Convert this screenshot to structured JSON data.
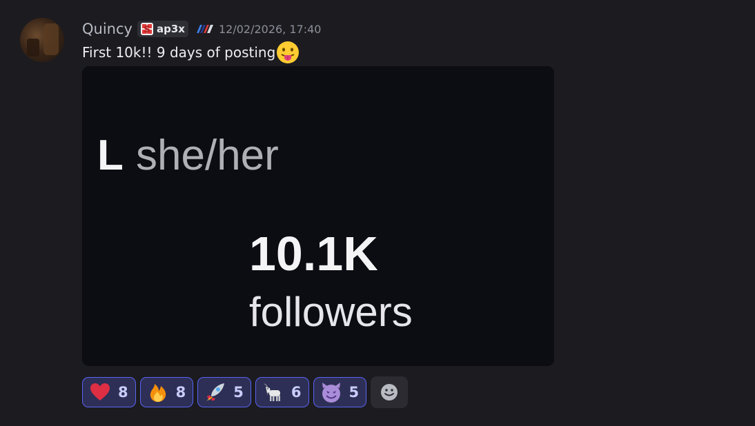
{
  "message": {
    "author": "Quincy",
    "guild_tag": "ap3x",
    "timestamp": "12/02/2026, 17:40",
    "text": "First 10k!! 9 days of posting",
    "text_emoji": "face-with-tongue"
  },
  "attachment": {
    "logo_letter": "L",
    "pronouns": "she/her",
    "follower_count": "10.1K",
    "follower_label": "followers"
  },
  "reactions": [
    {
      "emoji": "red-heart",
      "count": "8"
    },
    {
      "emoji": "fire",
      "count": "8"
    },
    {
      "emoji": "rocket",
      "count": "5"
    },
    {
      "emoji": "goat",
      "count": "6"
    },
    {
      "emoji": "smiling-imp",
      "count": "5"
    }
  ],
  "colors": {
    "background": "#1c1b20",
    "reaction_accent": "#5865f2",
    "reaction_fill": "#2e2f56"
  }
}
